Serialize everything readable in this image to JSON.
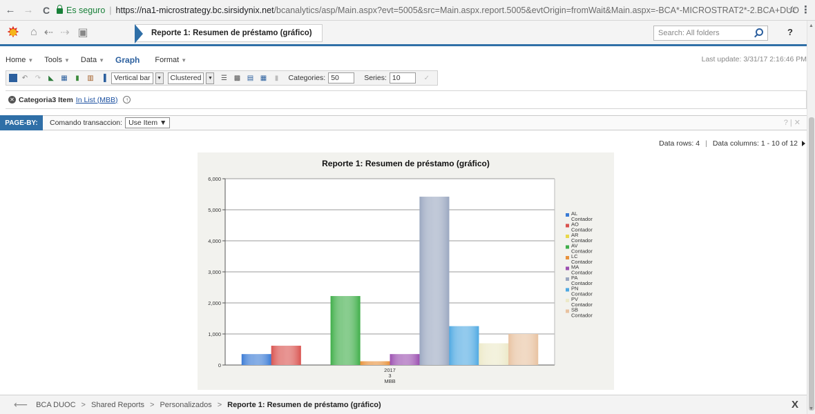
{
  "browser": {
    "back": "←",
    "forward": "→",
    "reload": "C",
    "secure_label": "Es seguro",
    "url_host": "https://na1-microstrategy.bc.sirsidynix.net",
    "url_rest": "/bcanalytics/asp/Main.aspx?evt=5005&src=Main.aspx.report.5005&evtOrigin=fromWait&Main.aspx=-BCA*-MICROSTRAT2*-2.BCA+DUO",
    "star": "☆",
    "menu": "⋮"
  },
  "header": {
    "report_title": "Reporte 1: Resumen de préstamo (gráfico)",
    "search_placeholder": "Search: All folders",
    "help": "?"
  },
  "menubar": {
    "items": [
      {
        "label": "Home"
      },
      {
        "label": "Tools"
      },
      {
        "label": "Data"
      },
      {
        "label": "Graph"
      },
      {
        "label": "Format"
      }
    ],
    "last_update": "Last update: 3/31/17 2:16:46 PM"
  },
  "toolbar": {
    "chart_type": "Vertical bar",
    "chart_subtype": "Clustered",
    "categories_label": "Categories:",
    "categories_value": "50",
    "series_label": "Series:",
    "series_value": "10"
  },
  "filter": {
    "text": "Categoria3 Item",
    "link": "In List (MBB)"
  },
  "pageby": {
    "tag": "PAGE-BY:",
    "label": "Comando transaccion:",
    "value": "Use Item ▼"
  },
  "datainfo": {
    "rows": "Data rows: 4",
    "columns": "Data columns: 1 - 10 of 12"
  },
  "colors": {
    "accent": "#2f6fa7"
  },
  "chart_data": {
    "type": "bar",
    "title": "Reporte 1: Resumen de préstamo (gráfico)",
    "categories": [
      "2017\n3\nMBB"
    ],
    "ylim": [
      0,
      6000
    ],
    "yticks": [
      "0",
      "1,000",
      "2,000",
      "3,000",
      "4,000",
      "5,000",
      "6,000"
    ],
    "legend_position": "right",
    "series": [
      {
        "name": "AL Contador",
        "values": [
          350
        ],
        "color": "#3a7bd5"
      },
      {
        "name": "AO Contador",
        "values": [
          620
        ],
        "color": "#d9534f"
      },
      {
        "name": "AR Contador",
        "values": [
          0
        ],
        "color": "#e8d84a"
      },
      {
        "name": "AV Contador",
        "values": [
          2220
        ],
        "color": "#3fae49"
      },
      {
        "name": "LC Contador",
        "values": [
          120
        ],
        "color": "#e8913a"
      },
      {
        "name": "MA Contador",
        "values": [
          350
        ],
        "color": "#9b4fb0"
      },
      {
        "name": "PA Contador",
        "values": [
          5420
        ],
        "color": "#9aa7c0"
      },
      {
        "name": "PN Contador",
        "values": [
          1250
        ],
        "color": "#4fa9e2"
      },
      {
        "name": "PV Contador",
        "values": [
          700
        ],
        "color": "#ece9c8"
      },
      {
        "name": "SB Contador",
        "values": [
          1000
        ],
        "color": "#e8c2a0"
      }
    ]
  },
  "bottom": {
    "crumbs": [
      "BCA DUOC",
      "Shared Reports",
      "Personalizados"
    ],
    "current": "Reporte 1: Resumen de préstamo (gráfico)",
    "close": "X"
  }
}
